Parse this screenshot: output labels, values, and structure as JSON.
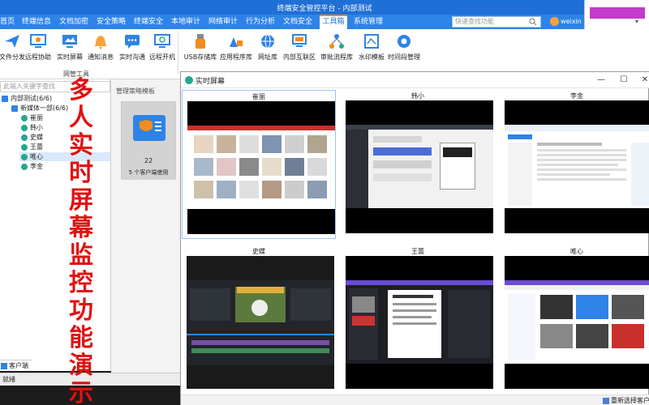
{
  "app": {
    "title": "终端安全管控平台 - 内部测试"
  },
  "nav": {
    "tabs": [
      "首页",
      "终端信息",
      "文档加密",
      "安全策略",
      "终端安全",
      "本地审计",
      "网络审计",
      "行为分析",
      "文档安全",
      "工具箱",
      "系统管理"
    ],
    "active_tab": "工具箱",
    "search_placeholder": "快速查找功能",
    "user_name": "weixin"
  },
  "toolbar": {
    "tools": [
      "文件分发",
      "远程协助",
      "实时屏幕",
      "通知消息",
      "实时沟通",
      "远程开机",
      "USB存储库",
      "应用程序库",
      "网址库",
      "内部互联区",
      "审批流程库",
      "水印模板",
      "时间段管理"
    ],
    "group_label": "网管工具"
  },
  "tree": {
    "search_placeholder": "此输入关键字查找",
    "nodes": [
      {
        "label": "内部测试(6/6)",
        "level": 0,
        "icon": "org-icon"
      },
      {
        "label": "新媒体一部(6/6)",
        "level": 1,
        "icon": "org-icon"
      },
      {
        "label": "崔丽",
        "level": 2,
        "icon": "user-online-icon"
      },
      {
        "label": "韩小",
        "level": 2,
        "icon": "user-online-icon"
      },
      {
        "label": "史蝶",
        "level": 2,
        "icon": "user-online-icon"
      },
      {
        "label": "王蕾",
        "level": 2,
        "icon": "user-online-icon"
      },
      {
        "label": "唯心",
        "level": 2,
        "icon": "user-online-icon",
        "selected": true
      },
      {
        "label": "李金",
        "level": 2,
        "icon": "user-online-icon"
      }
    ],
    "bottom_tab": "客户端"
  },
  "status": {
    "text": "就绪"
  },
  "policy": {
    "header": "管理策略模板",
    "count": "22",
    "caption": "5 个客户端使用"
  },
  "overlay": {
    "caption": "多人实时屏幕监控功能演示",
    "color": "#e01111"
  },
  "screen_window": {
    "title": "实时屏幕",
    "controls": {
      "minimize": "—",
      "maximize": "☐",
      "close": "✕"
    },
    "clients": [
      "崔丽",
      "韩小",
      "李金",
      "史蝶",
      "王蕾",
      "唯心"
    ],
    "selected_client": "崔丽",
    "reselect_label": "重新选择客户端"
  },
  "colors": {
    "brand_blue": "#1f6fd6",
    "nav_blue": "#2e83e6",
    "active_border": "#f28c1c",
    "online_green": "#22a88d"
  }
}
